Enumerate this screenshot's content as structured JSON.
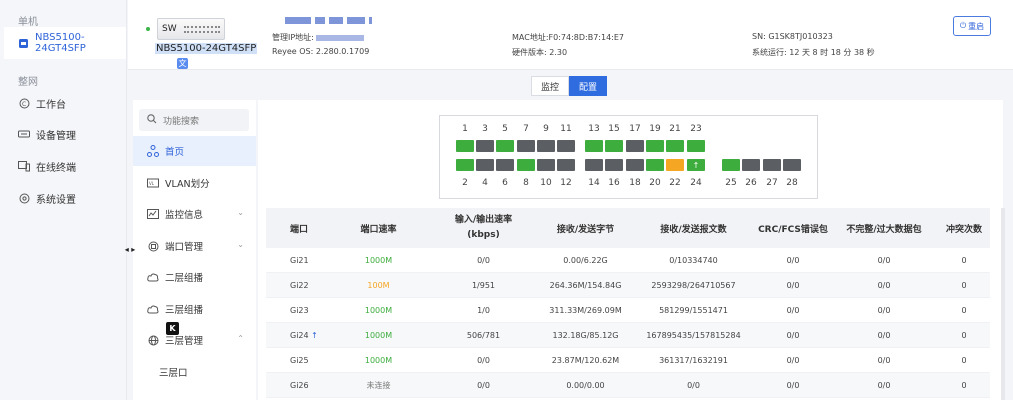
{
  "sidebar": {
    "section_single": "单机",
    "device_item": "NBS5100-24GT4SFP",
    "section_network": "整网",
    "items": [
      {
        "label": "工作台",
        "icon": "dashboard-icon"
      },
      {
        "label": "设备管理",
        "icon": "device-icon"
      },
      {
        "label": "在线终端",
        "icon": "terminal-icon"
      },
      {
        "label": "系统设置",
        "icon": "gear-icon"
      }
    ]
  },
  "header": {
    "device_label": "SW",
    "device_name": "NBS5100-24GT4SFP",
    "mgmt_ip_label": "管理IP地址:",
    "os_label": "Reyee OS:",
    "os_value": "2.280.0.1709",
    "mac_label": "MAC地址:",
    "mac_value": "F0:74:8D:B7:14:E7",
    "hw_label": "硬件版本:",
    "hw_value": "2.30",
    "sn_label": "SN:",
    "sn_value": "G1SK8TJ010323",
    "uptime_label": "系统运行:",
    "uptime_value": "12 天 8 时 18 分 38 秒",
    "restart_label": "重启"
  },
  "tabs": [
    "监控",
    "配置"
  ],
  "active_tab": "配置",
  "menu": {
    "search_placeholder": "功能搜索",
    "items": [
      {
        "label": "首页",
        "icon": "topology-icon"
      },
      {
        "label": "VLAN划分",
        "icon": "vlan-icon"
      },
      {
        "label": "监控信息",
        "icon": "monitor-icon"
      },
      {
        "label": "端口管理",
        "icon": "port-icon"
      },
      {
        "label": "二层组播",
        "icon": "cloud-icon"
      },
      {
        "label": "三层组播",
        "icon": "cloud-icon"
      },
      {
        "label": "三层管理",
        "icon": "globe-icon"
      },
      {
        "label": "三层口",
        "icon": ""
      }
    ],
    "tooltip_glyph": "K"
  },
  "port_panel": {
    "top_numbers": [
      "1",
      "3",
      "5",
      "7",
      "9",
      "11",
      "13",
      "15",
      "17",
      "19",
      "21",
      "23"
    ],
    "bottom_numbers": [
      "2",
      "4",
      "6",
      "8",
      "10",
      "12",
      "14",
      "16",
      "18",
      "20",
      "22",
      "24",
      "25",
      "26",
      "27",
      "28"
    ],
    "top_status": [
      "up",
      "down",
      "up",
      "down",
      "down",
      "down",
      "up",
      "up",
      "down",
      "up",
      "up",
      "up"
    ],
    "bottom_status": [
      "up",
      "down",
      "down",
      "up",
      "down",
      "down",
      "down",
      "down",
      "down",
      "up",
      "orange",
      "up-arrow",
      "up",
      "down",
      "down",
      "down"
    ],
    "colors": {
      "up": "#3dad3d",
      "down": "#5b5e63",
      "orange": "#f5a623"
    }
  },
  "table": {
    "headers": [
      "端口",
      "端口速率",
      "输入/输出速率\n(kbps)",
      "接收/发送字节",
      "接收/发送报文数",
      "CRC/FCS错误包",
      "不完整/过大数据包",
      "冲突次数"
    ],
    "rows": [
      {
        "port": "Gi21",
        "speed": "1000M",
        "speed_color": "green",
        "rate": "0/0",
        "bytes": "0.00/6.22G",
        "packets": "0/10334740",
        "crc": "0/0",
        "incomplete": "0/0",
        "collision": "0",
        "uplink": false
      },
      {
        "port": "Gi22",
        "speed": "100M",
        "speed_color": "orange",
        "rate": "1/951",
        "bytes": "264.36M/154.84G",
        "packets": "2593298/264710567",
        "crc": "0/0",
        "incomplete": "0/0",
        "collision": "0",
        "uplink": false
      },
      {
        "port": "Gi23",
        "speed": "1000M",
        "speed_color": "green",
        "rate": "1/0",
        "bytes": "311.33M/269.09M",
        "packets": "581299/1551471",
        "crc": "0/0",
        "incomplete": "0/0",
        "collision": "0",
        "uplink": false
      },
      {
        "port": "Gi24",
        "speed": "1000M",
        "speed_color": "green",
        "rate": "506/781",
        "bytes": "132.18G/85.12G",
        "packets": "167895435/157815284",
        "crc": "0/0",
        "incomplete": "0/0",
        "collision": "0",
        "uplink": true
      },
      {
        "port": "Gi25",
        "speed": "1000M",
        "speed_color": "green",
        "rate": "0/0",
        "bytes": "23.87M/120.62M",
        "packets": "361317/1632191",
        "crc": "0/0",
        "incomplete": "0/0",
        "collision": "0",
        "uplink": false
      },
      {
        "port": "Gi26",
        "speed": "未连接",
        "speed_color": "gray",
        "rate": "0/0",
        "bytes": "0.00/0.00",
        "packets": "0/0",
        "crc": "0/0",
        "incomplete": "0/0",
        "collision": "0",
        "uplink": false
      }
    ]
  }
}
